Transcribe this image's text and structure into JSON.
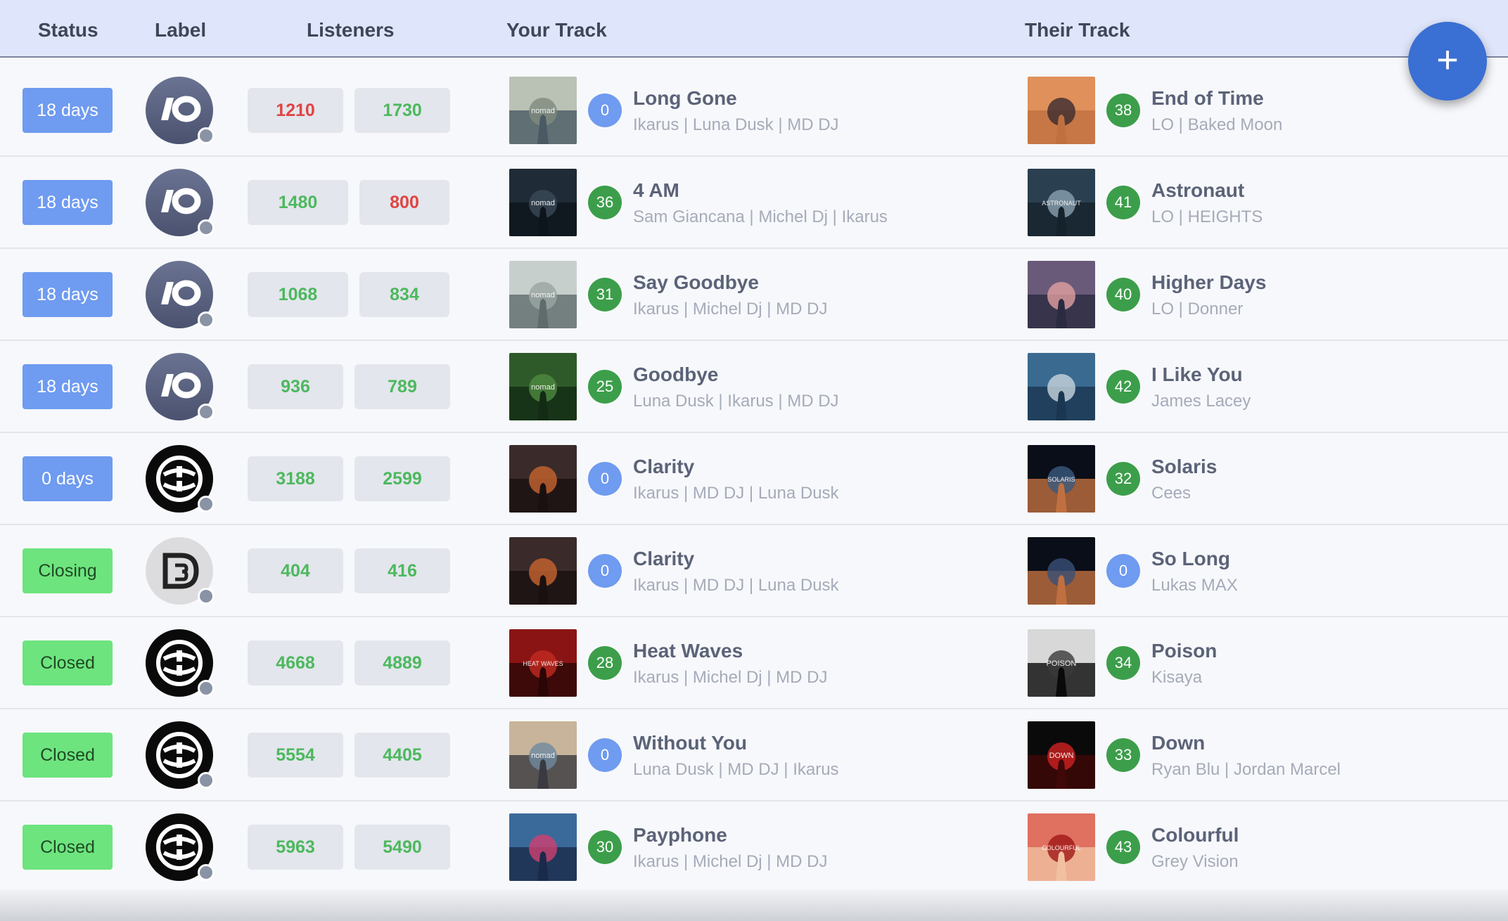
{
  "header": {
    "status": "Status",
    "label": "Label",
    "listeners": "Listeners",
    "your_track": "Your Track",
    "their_track": "Their Track"
  },
  "add_button": "+",
  "colors": {
    "status_active": "#6f9bf0",
    "status_done": "#6de47e",
    "score_green": "#3c9e4a",
    "score_blue": "#6f9bf0",
    "listeners_green": "#4db85e",
    "listeners_red": "#e04444"
  },
  "rows": [
    {
      "status": "18 days",
      "status_kind": "active",
      "label_icon": "lo-logo-icon",
      "listeners": [
        {
          "value": "1210",
          "color": "red"
        },
        {
          "value": "1730",
          "color": "green"
        }
      ],
      "yours": {
        "title": "Long Gone",
        "artists": "Ikarus | Luna Dusk | MD DJ",
        "score": "0",
        "score_color": "blue",
        "cover_text": "nomad"
      },
      "theirs": {
        "title": "End of Time",
        "artists": "LO | Baked Moon",
        "score": "38",
        "score_color": "green"
      }
    },
    {
      "status": "18 days",
      "status_kind": "active",
      "label_icon": "lo-logo-icon",
      "listeners": [
        {
          "value": "1480",
          "color": "green"
        },
        {
          "value": "800",
          "color": "red"
        }
      ],
      "yours": {
        "title": "4 AM",
        "artists": "Sam Giancana | Michel Dj | Ikarus",
        "score": "36",
        "score_color": "green",
        "cover_text": "nomad"
      },
      "theirs": {
        "title": "Astronaut",
        "artists": "LO | HEIGHTS",
        "score": "41",
        "score_color": "green",
        "cover_text": "ASTRONAUT"
      }
    },
    {
      "status": "18 days",
      "status_kind": "active",
      "label_icon": "lo-logo-icon",
      "listeners": [
        {
          "value": "1068",
          "color": "green"
        },
        {
          "value": "834",
          "color": "green"
        }
      ],
      "yours": {
        "title": "Say Goodbye",
        "artists": "Ikarus | Michel Dj | MD DJ",
        "score": "31",
        "score_color": "green",
        "cover_text": "nomad"
      },
      "theirs": {
        "title": "Higher Days",
        "artists": "LO | Donner",
        "score": "40",
        "score_color": "green"
      }
    },
    {
      "status": "18 days",
      "status_kind": "active",
      "label_icon": "lo-logo-icon",
      "listeners": [
        {
          "value": "936",
          "color": "green"
        },
        {
          "value": "789",
          "color": "green"
        }
      ],
      "yours": {
        "title": "Goodbye",
        "artists": "Luna Dusk | Ikarus | MD DJ",
        "score": "25",
        "score_color": "green",
        "cover_text": "nomad"
      },
      "theirs": {
        "title": "I Like You",
        "artists": "James Lacey",
        "score": "42",
        "score_color": "green"
      }
    },
    {
      "status": "0 days",
      "status_kind": "active",
      "label_icon": "swirl-logo-icon",
      "listeners": [
        {
          "value": "3188",
          "color": "green"
        },
        {
          "value": "2599",
          "color": "green"
        }
      ],
      "yours": {
        "title": "Clarity",
        "artists": "Ikarus | MD DJ | Luna Dusk",
        "score": "0",
        "score_color": "blue"
      },
      "theirs": {
        "title": "Solaris",
        "artists": "Cees",
        "score": "32",
        "score_color": "green",
        "cover_text": "SOLARIS"
      }
    },
    {
      "status": "Closing",
      "status_kind": "done",
      "label_icon": "d3-logo-icon",
      "listeners": [
        {
          "value": "404",
          "color": "green"
        },
        {
          "value": "416",
          "color": "green"
        }
      ],
      "yours": {
        "title": "Clarity",
        "artists": "Ikarus | MD DJ | Luna Dusk",
        "score": "0",
        "score_color": "blue"
      },
      "theirs": {
        "title": "So Long",
        "artists": "Lukas MAX",
        "score": "0",
        "score_color": "blue"
      }
    },
    {
      "status": "Closed",
      "status_kind": "done",
      "label_icon": "swirl-logo-icon",
      "listeners": [
        {
          "value": "4668",
          "color": "green"
        },
        {
          "value": "4889",
          "color": "green"
        }
      ],
      "yours": {
        "title": "Heat Waves",
        "artists": "Ikarus | Michel Dj | MD DJ",
        "score": "28",
        "score_color": "green",
        "cover_text": "HEAT WAVES"
      },
      "theirs": {
        "title": "Poison",
        "artists": "Kisaya",
        "score": "34",
        "score_color": "green",
        "cover_text": "POISON"
      }
    },
    {
      "status": "Closed",
      "status_kind": "done",
      "label_icon": "swirl-logo-icon",
      "listeners": [
        {
          "value": "5554",
          "color": "green"
        },
        {
          "value": "4405",
          "color": "green"
        }
      ],
      "yours": {
        "title": "Without You",
        "artists": "Luna Dusk | MD DJ | Ikarus",
        "score": "0",
        "score_color": "blue",
        "cover_text": "nomad"
      },
      "theirs": {
        "title": "Down",
        "artists": "Ryan Blu | Jordan Marcel",
        "score": "33",
        "score_color": "green",
        "cover_text": "DOWN"
      }
    },
    {
      "status": "Closed",
      "status_kind": "done",
      "label_icon": "swirl-logo-icon",
      "listeners": [
        {
          "value": "5963",
          "color": "green"
        },
        {
          "value": "5490",
          "color": "green"
        }
      ],
      "yours": {
        "title": "Payphone",
        "artists": "Ikarus | Michel Dj | MD DJ",
        "score": "30",
        "score_color": "green"
      },
      "theirs": {
        "title": "Colourful",
        "artists": "Grey Vision",
        "score": "43",
        "score_color": "green",
        "cover_text": "COLOURFUL"
      }
    }
  ]
}
